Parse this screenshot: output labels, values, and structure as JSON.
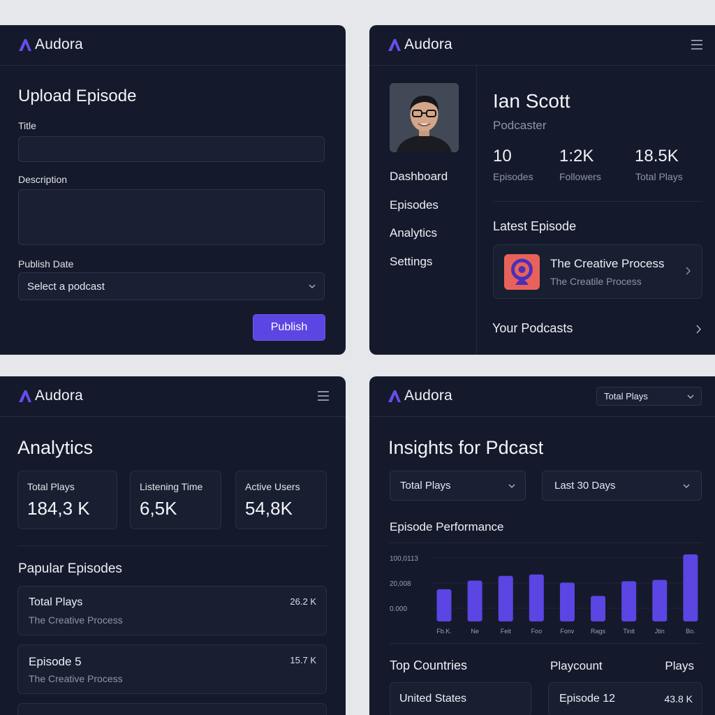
{
  "brand": {
    "name": "Audora",
    "accent": "#5b45e3"
  },
  "upload": {
    "title": "Upload Episode",
    "title_label": "Title",
    "title_value": "",
    "description_label": "Description",
    "description_value": "",
    "publish_date_label": "Publish Date",
    "podcast_select_value": "Select a podcast",
    "publish_button": "Publish"
  },
  "profile": {
    "name": "Ian Scott",
    "role": "Podcaster",
    "nav": [
      "Dashboard",
      "Episodes",
      "Analytics",
      "Settings"
    ],
    "stats": [
      {
        "value": "10",
        "label": "Episodes"
      },
      {
        "value": "1:2K",
        "label": "Followers"
      },
      {
        "value": "18.5K",
        "label": "Total Plays"
      }
    ],
    "latest_heading": "Latest Episode",
    "latest_title": "The Creative Process",
    "latest_subtitle": "The Creatile Process",
    "your_podcasts": "Your Podcasts"
  },
  "analytics": {
    "title": "Analytics",
    "kpis": [
      {
        "label": "Total Plays",
        "value": "184,3 K"
      },
      {
        "label": "Listening Time",
        "value": "6,5K"
      },
      {
        "label": "Active Users",
        "value": "54,8K"
      }
    ],
    "popular_heading": "Papular Episodes",
    "episodes": [
      {
        "title": "Total Plays",
        "subtitle": "The Creative Process",
        "value": "26.2 K"
      },
      {
        "title": "Episode 5",
        "subtitle": "The Creative Process",
        "value": "15.7 K"
      }
    ]
  },
  "insights": {
    "header_select": "Total Plays",
    "title": "Insights for Pdcast",
    "metric_select": "Total Plays",
    "range_select": "Last 30 Days",
    "perf_heading": "Episode Performance",
    "top_countries_heading": "Top Countries",
    "playcount_heading": "Playcount",
    "plays_heading": "Plays",
    "country_row": "United States",
    "playcount_row_title": "Episode 12",
    "playcount_row_value": "43.8 K"
  },
  "chart_data": {
    "type": "bar",
    "title": "Episode Performance",
    "y_tick_labels": [
      "100,0113",
      "20,008",
      "0.000"
    ],
    "categories": [
      "Fb.K.",
      "Ne",
      "Feit",
      "Foo",
      "Fonv",
      "Rags",
      "Tinit",
      "Jtin",
      "Bo."
    ],
    "values": [
      48,
      61,
      68,
      70,
      58,
      38,
      60,
      62,
      100
    ],
    "ylim": [
      0,
      100
    ],
    "color": "#5b45e3",
    "grid": true
  }
}
